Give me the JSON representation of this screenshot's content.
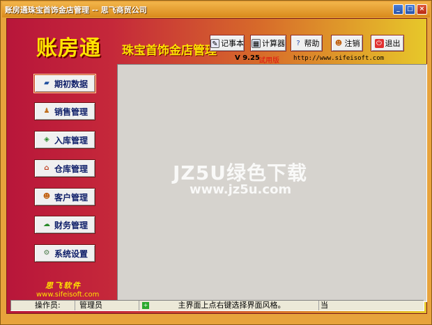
{
  "window": {
    "title": "账房通珠宝首饰金店管理 -- 思飞商贸公司",
    "controls": [
      "minimize-icon",
      "maximize-icon",
      "close-icon"
    ]
  },
  "header": {
    "logo": "账房通",
    "app_title": "珠宝首饰金店管理",
    "version": "V 9.25",
    "trial": "试用版",
    "url": "http://www.sifeisoft.com"
  },
  "toolbar": {
    "notepad": {
      "label": "记事本",
      "icon": "notepad-icon"
    },
    "calculator": {
      "label": "计算器",
      "icon": "calculator-icon"
    },
    "help": {
      "label": "帮助",
      "icon": "help-icon"
    },
    "logout": {
      "label": "注销",
      "icon": "users-icon"
    },
    "exit": {
      "label": "退出",
      "icon": "exit-icon"
    }
  },
  "nav": {
    "items": [
      {
        "label": "期初数据",
        "icon": "book-icon"
      },
      {
        "label": "销售管理",
        "icon": "sales-icon"
      },
      {
        "label": "入库管理",
        "icon": "box-icon"
      },
      {
        "label": "仓库管理",
        "icon": "warehouse-icon"
      },
      {
        "label": "客户管理",
        "icon": "customers-icon"
      },
      {
        "label": "财务管理",
        "icon": "finance-icon"
      },
      {
        "label": "系统设置",
        "icon": "settings-icon"
      }
    ]
  },
  "footer_brand": {
    "company": "思飞软件",
    "url": "www.sifeisoft.com"
  },
  "watermark": {
    "line1": "JZ5U绿色下载",
    "line2": "www.jz5u.com"
  },
  "statusbar": {
    "operator_label": "操作员:",
    "operator_value": "管理员",
    "hint": "主界面上点右键选择界面风格。",
    "date_label": "当"
  },
  "colors": {
    "accent_yellow": "#ffe400",
    "title_orange": "#e7a33c",
    "panel_gray": "#d6d3ce"
  }
}
